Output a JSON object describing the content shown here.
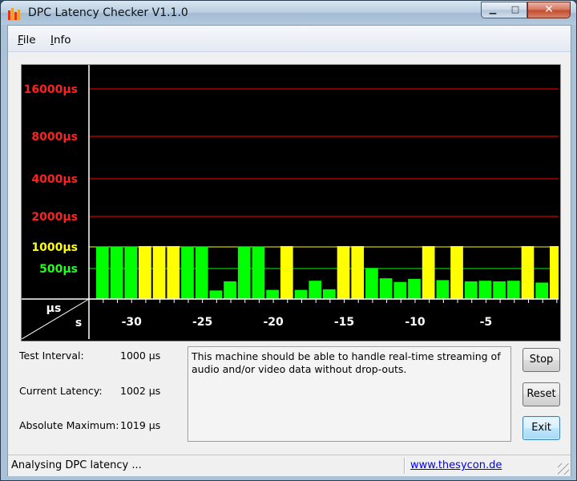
{
  "window": {
    "title": "DPC Latency Checker V1.1.0",
    "controls": {
      "minimize": "▁",
      "maximize": "□",
      "close": "✕"
    }
  },
  "menu": {
    "file": {
      "accel": "F",
      "rest": "ile"
    },
    "info": {
      "accel": "I",
      "rest": "nfo"
    }
  },
  "chart_data": {
    "type": "bar",
    "y_unit_label": "µs",
    "x_unit_label": "s",
    "y_ticks": [
      {
        "label": "16000µs",
        "color": "#ff2020"
      },
      {
        "label": "8000µs",
        "color": "#ff2020"
      },
      {
        "label": "4000µs",
        "color": "#ff2020"
      },
      {
        "label": "2000µs",
        "color": "#ff2020"
      },
      {
        "label": "1000µs",
        "color": "#ffff00"
      },
      {
        "label": "500µs",
        "color": "#20ff20"
      }
    ],
    "y_tick_values": [
      16000,
      8000,
      4000,
      2000,
      1000,
      500
    ],
    "x_ticks": [
      -30,
      -25,
      -20,
      -15,
      -10,
      -5
    ],
    "x_range": [
      -32,
      0
    ],
    "x": [
      -32,
      -31,
      -30,
      -29,
      -28,
      -27,
      -26,
      -25,
      -24,
      -23,
      -22,
      -21,
      -20,
      -19,
      -18,
      -17,
      -16,
      -15,
      -14,
      -13,
      -12,
      -11,
      -10,
      -9,
      -8,
      -7,
      -6,
      -5,
      -4,
      -3,
      -2,
      -1,
      0
    ],
    "values": [
      1002,
      1002,
      1002,
      1019,
      1019,
      1019,
      1002,
      1002,
      140,
      290,
      1002,
      1002,
      150,
      1019,
      150,
      300,
      160,
      1019,
      1019,
      510,
      340,
      280,
      330,
      1019,
      310,
      1019,
      290,
      300,
      290,
      300,
      1019,
      270,
      1019
    ],
    "colors": [
      "#00ff00",
      "#00ff00",
      "#00ff00",
      "#ffff00",
      "#ffff00",
      "#ffff00",
      "#00ff00",
      "#00ff00",
      "#00ff00",
      "#00ff00",
      "#00ff00",
      "#00ff00",
      "#00ff00",
      "#ffff00",
      "#00ff00",
      "#00ff00",
      "#00ff00",
      "#ffff00",
      "#ffff00",
      "#00ff00",
      "#00ff00",
      "#00ff00",
      "#00ff00",
      "#ffff00",
      "#00ff00",
      "#ffff00",
      "#00ff00",
      "#00ff00",
      "#00ff00",
      "#00ff00",
      "#ffff00",
      "#00ff00",
      "#ffff00"
    ],
    "grid_color_high": "#ff0000",
    "grid_color_1000": "#ffff00",
    "grid_color_500": "#00ff00",
    "background": "#000000"
  },
  "info": {
    "test_interval_label": "Test Interval:",
    "test_interval_value": "1000 µs",
    "current_latency_label": "Current Latency:",
    "current_latency_value": "1002 µs",
    "absolute_maximum_label": "Absolute Maximum:",
    "absolute_maximum_value": "1019 µs"
  },
  "message": "This machine should be able to handle real-time streaming of audio and/or video data without drop-outs.",
  "buttons": {
    "stop": "Stop",
    "reset": "Reset",
    "exit": "Exit"
  },
  "status": {
    "text": "Analysing DPC latency ...",
    "link": "www.thesycon.de"
  }
}
